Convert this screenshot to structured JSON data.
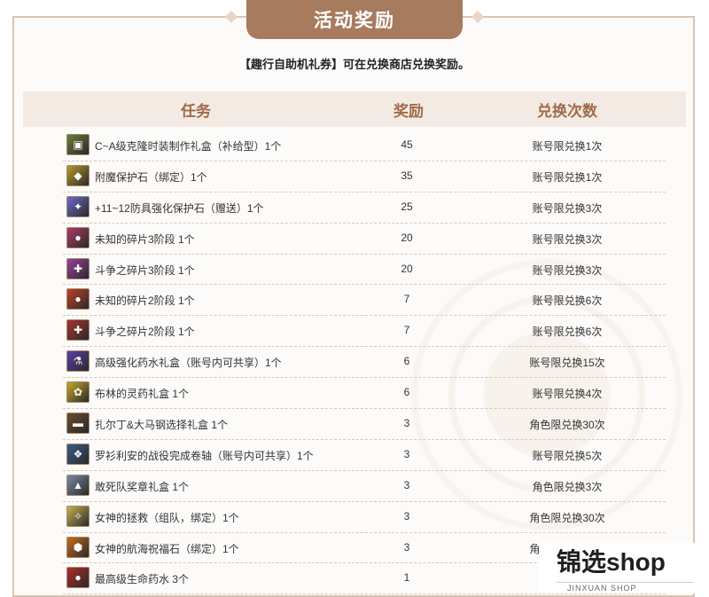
{
  "header": {
    "title": "活动奖励"
  },
  "notice": "【趣行自助机礼券】可在兑换商店兑换奖励。",
  "table": {
    "columns": [
      "任务",
      "奖励",
      "兑换次数"
    ],
    "rows": [
      {
        "item": "C~A级克隆时装制作礼盒（补给型）1个",
        "reward": "45",
        "limit": "账号限兑换1次",
        "icon": "box-icon",
        "color": "#6b7a3a",
        "glyph": "▣"
      },
      {
        "item": "附魔保护石（绑定）1个",
        "reward": "35",
        "limit": "账号限兑换1次",
        "icon": "stone-icon",
        "color": "#b89a2c",
        "glyph": "◆"
      },
      {
        "item": "+11~12防具强化保护石（赠送）1个",
        "reward": "25",
        "limit": "账号限兑换3次",
        "icon": "crystal-icon",
        "color": "#6c6acb",
        "glyph": "✦"
      },
      {
        "item": "未知的碎片3阶段 1个",
        "reward": "20",
        "limit": "账号限兑换3次",
        "icon": "fragment-icon",
        "color": "#b03a6a",
        "glyph": "●"
      },
      {
        "item": "斗争之碎片3阶段 1个",
        "reward": "20",
        "limit": "账号限兑换3次",
        "icon": "fragment-icon",
        "color": "#9a3fa0",
        "glyph": "✚"
      },
      {
        "item": "未知的碎片2阶段 1个",
        "reward": "7",
        "limit": "账号限兑换6次",
        "icon": "fragment-icon",
        "color": "#c0402a",
        "glyph": "●"
      },
      {
        "item": "斗争之碎片2阶段 1个",
        "reward": "7",
        "limit": "账号限兑换6次",
        "icon": "fragment-icon",
        "color": "#a8322e",
        "glyph": "✚"
      },
      {
        "item": "高级强化药水礼盒（账号内可共享）1个",
        "reward": "6",
        "limit": "账号限兑换15次",
        "icon": "potion-icon",
        "color": "#5a3fa8",
        "glyph": "⚗"
      },
      {
        "item": "布林的灵药礼盒 1个",
        "reward": "6",
        "limit": "账号限兑换4次",
        "icon": "potion-icon",
        "color": "#c8a82a",
        "glyph": "✿"
      },
      {
        "item": "扎尔丁&大马钢选择礼盒 1个",
        "reward": "3",
        "limit": "角色限兑换30次",
        "icon": "box-icon",
        "color": "#6b4a2e",
        "glyph": "▬"
      },
      {
        "item": "罗衫利安的战役完成卷轴（账号内可共享）1个",
        "reward": "3",
        "limit": "账号限兑换5次",
        "icon": "scroll-icon",
        "color": "#3a5a8a",
        "glyph": "❖"
      },
      {
        "item": "敢死队奖章礼盒 1个",
        "reward": "3",
        "limit": "角色限兑换3次",
        "icon": "medal-icon",
        "color": "#7a8aa8",
        "glyph": "▲"
      },
      {
        "item": "女神的拯救（组队，绑定）1个",
        "reward": "3",
        "limit": "角色限兑换30次",
        "icon": "goddess-icon",
        "color": "#c8b050",
        "glyph": "✧"
      },
      {
        "item": "女神的航海祝福石（绑定）1个",
        "reward": "3",
        "limit": "角色限兑换30次",
        "icon": "gem-icon",
        "color": "#c86a1a",
        "glyph": "⬢"
      },
      {
        "item": "最高级生命药水 3个",
        "reward": "1",
        "limit": "",
        "icon": "potion-icon",
        "color": "#b02a2a",
        "glyph": "●"
      }
    ]
  },
  "watermark": {
    "brand": "锦选shop",
    "sub": "JINXUAN SHOP"
  }
}
